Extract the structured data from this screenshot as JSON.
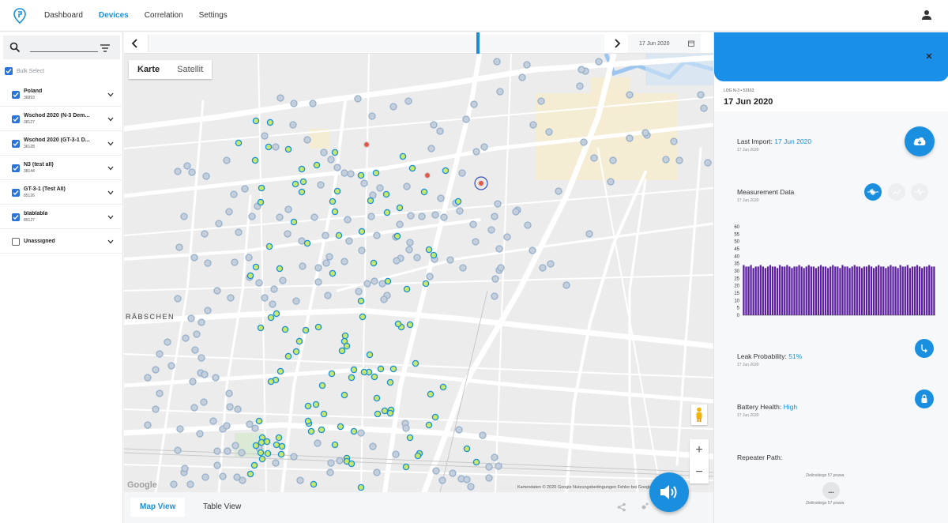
{
  "nav": {
    "items": [
      "Dashboard",
      "Devices",
      "Correlation",
      "Settings"
    ],
    "active": "Devices"
  },
  "sidebar": {
    "bulk_select": "Bulk Select",
    "groups": [
      {
        "name": "Poland",
        "count": "36893",
        "checked": true
      },
      {
        "name": "Wschod 2020 (N-3 Dem...",
        "count": "38127",
        "checked": true
      },
      {
        "name": "Wschod 2020 (GT-3-1 D...",
        "count": "36128",
        "checked": true
      },
      {
        "name": "N3 (test all)",
        "count": "38144",
        "checked": true
      },
      {
        "name": "GT-3-1 (Test All)",
        "count": "85126",
        "checked": true
      },
      {
        "name": "blablabla",
        "count": "85127",
        "checked": true
      },
      {
        "name": "Unassigned",
        "count": "",
        "checked": false
      }
    ]
  },
  "timeline": {
    "date": "17 Jun 2020"
  },
  "map": {
    "type_buttons": [
      "Karte",
      "Satellit"
    ],
    "district_label": "RÄBSCHEN",
    "google_logo": "Google",
    "attribution": "Kartendaten © 2020 Google    Nutzungsbedingungen    Fehler bei Google Maps melden",
    "zoom_in": "+",
    "zoom_out": "−"
  },
  "bottom_tabs": {
    "map_view": "Map View",
    "table_view": "Table View"
  },
  "panel": {
    "device_id": "LOG N-3 • 53163",
    "date": "17 Jun 2020",
    "last_import_label": "Last Import:",
    "last_import_value": "17 Jun 2020",
    "last_import_sub": "17 Jun 2020",
    "measurement_label": "Measurement Data",
    "measurement_sub": "17 Jun 2020",
    "leak_label": "Leak Probability:",
    "leak_value": "51%",
    "leak_sub": "17 Jun 2020",
    "battery_label": "Battery Health:",
    "battery_value": "High",
    "battery_sub": "17 Jun 2020",
    "repeater_label": "Repeater Path:",
    "repeater_from": "Zielinskiego 57 prawa",
    "repeater_to": "Zielinskiego 57 prawa",
    "repeater_more": "...",
    "colors": {
      "accent": "#1a8fe0",
      "bar": "#5b1e9e"
    }
  },
  "chart_data": {
    "type": "bar",
    "y_ticks": [
      "0",
      "5",
      "10",
      "15",
      "20",
      "25",
      "30",
      "35",
      "40",
      "45",
      "50",
      "55",
      "60"
    ],
    "ylim": [
      0,
      60
    ],
    "values": [
      34,
      33,
      33,
      34,
      32,
      33,
      33,
      34,
      33,
      32,
      33,
      34,
      33,
      33,
      32,
      34,
      33,
      33,
      34,
      33,
      32,
      33,
      33,
      34,
      33,
      32,
      33,
      34,
      33,
      33,
      32,
      33,
      34,
      33,
      33,
      32,
      33,
      34,
      33,
      33,
      32,
      34,
      33,
      33,
      32,
      33,
      34,
      33,
      33,
      32,
      33,
      33,
      34,
      33,
      32,
      33,
      34,
      33,
      33,
      32,
      33,
      34,
      33,
      33,
      32,
      34,
      33,
      33,
      34,
      32,
      33,
      33,
      34,
      33,
      32,
      33,
      33,
      34,
      33,
      33
    ]
  },
  "colors": {
    "dot_green_fill": "#c6e86b",
    "dot_green_ring": "#1a8fd8",
    "dot_grey_fill": "#c5cfdc",
    "dot_grey_ring": "#96b0cc",
    "dot_red": "#e05a4a"
  }
}
